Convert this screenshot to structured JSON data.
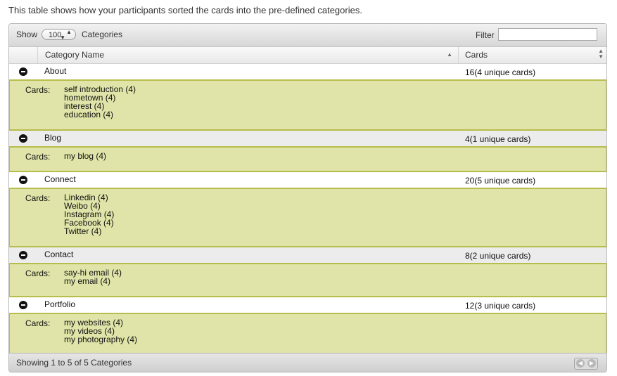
{
  "intro": "This table shows how your participants sorted the cards into the pre-defined categories.",
  "toolbar": {
    "show_label": "Show",
    "show_value": "100",
    "after_select_label": "Categories",
    "filter_label": "Filter",
    "filter_value": ""
  },
  "columns": {
    "category_name": "Category Name",
    "cards": "Cards"
  },
  "cards_label": "Cards:",
  "categories": [
    {
      "name": "About",
      "count": "16(4 unique cards)",
      "cards": [
        "self introduction (4)",
        "hometown (4)",
        "interest (4)",
        "education (4)"
      ]
    },
    {
      "name": "Blog",
      "count": "4(1 unique cards)",
      "cards": [
        "my blog (4)"
      ]
    },
    {
      "name": "Connect",
      "count": "20(5 unique cards)",
      "cards": [
        "Linkedin (4)",
        "Weibo (4)",
        "Instagram (4)",
        "Facebook (4)",
        "Twitter (4)"
      ]
    },
    {
      "name": "Contact",
      "count": "8(2 unique cards)",
      "cards": [
        "say-hi email (4)",
        "my email (4)"
      ]
    },
    {
      "name": "Portfolio",
      "count": "12(3 unique cards)",
      "cards": [
        "my websites (4)",
        "my videos (4)",
        "my photography (4)"
      ]
    }
  ],
  "footer": {
    "info": "Showing 1 to 5 of 5 Categories"
  }
}
